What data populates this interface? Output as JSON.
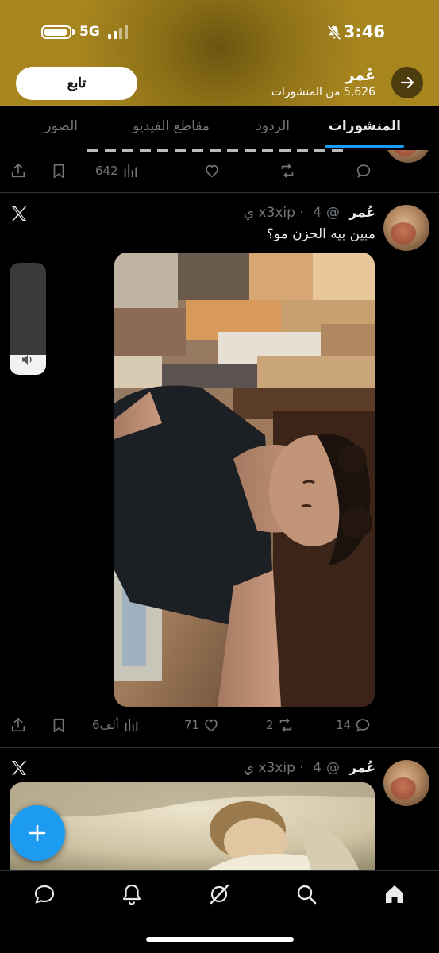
{
  "status_bar": {
    "time": "3:46",
    "network": "5G"
  },
  "header": {
    "name": "عُمر",
    "post_count": "5,626 من المنشورات",
    "follow_label": "تابع"
  },
  "tabs": [
    {
      "label": "المنشورات",
      "active": true
    },
    {
      "label": "الردود",
      "active": false
    },
    {
      "label": "مقاطع الفيديو",
      "active": false
    },
    {
      "label": "الصور",
      "active": false
    }
  ],
  "prev_post": {
    "actions": {
      "replies": "",
      "reposts": "",
      "likes": "",
      "views": "642"
    }
  },
  "posts": [
    {
      "author": "عُمر",
      "handle": "@x3xip",
      "time": "4 ي",
      "text": "مبين بيه الحزن مو؟",
      "actions": {
        "replies": "14",
        "reposts": "2",
        "likes": "71",
        "views": "6ألف"
      }
    },
    {
      "author": "عُمر",
      "handle": "@x3xip",
      "time": "4 ي"
    }
  ],
  "volume_level": 0.18,
  "colors": {
    "accent": "#1d9bf0",
    "banner": "#a8861f",
    "muted": "#71767b",
    "divider": "#2f3336"
  }
}
